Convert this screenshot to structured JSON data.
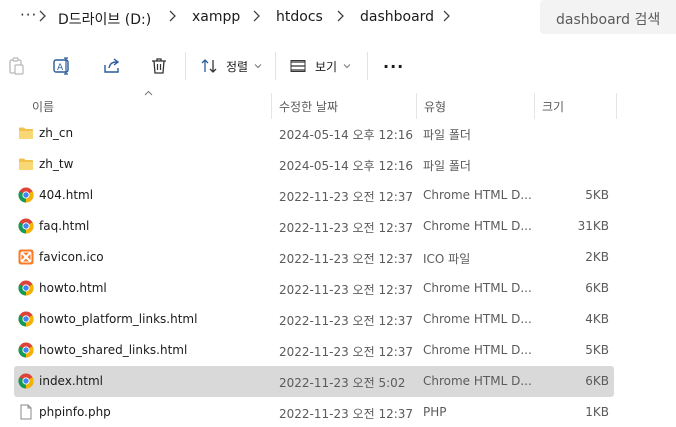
{
  "address_bar": {
    "overflow": "···",
    "breadcrumbs": [
      "D드라이브 (D:)",
      "xampp",
      "htdocs",
      "dashboard"
    ],
    "search_placeholder": "dashboard 검색"
  },
  "toolbar": {
    "sort_label": "정렬",
    "view_label": "보기",
    "more_label": "···"
  },
  "columns": {
    "name": "이름",
    "modified": "수정한 날짜",
    "type": "유형",
    "size": "크기"
  },
  "files": [
    {
      "name": "zh_cn",
      "modified": "2024-05-14 오후 12:16",
      "type": "파일 폴더",
      "size": "",
      "icon": "folder-icon",
      "selected": false
    },
    {
      "name": "zh_tw",
      "modified": "2024-05-14 오후 12:16",
      "type": "파일 폴더",
      "size": "",
      "icon": "folder-icon",
      "selected": false
    },
    {
      "name": "404.html",
      "modified": "2022-11-23 오전 12:37",
      "type": "Chrome HTML D...",
      "size": "5KB",
      "icon": "chrome-icon",
      "selected": false
    },
    {
      "name": "faq.html",
      "modified": "2022-11-23 오전 12:37",
      "type": "Chrome HTML D...",
      "size": "31KB",
      "icon": "chrome-icon",
      "selected": false
    },
    {
      "name": "favicon.ico",
      "modified": "2022-11-23 오전 12:37",
      "type": "ICO 파일",
      "size": "2KB",
      "icon": "xampp-icon",
      "selected": false
    },
    {
      "name": "howto.html",
      "modified": "2022-11-23 오전 12:37",
      "type": "Chrome HTML D...",
      "size": "6KB",
      "icon": "chrome-icon",
      "selected": false
    },
    {
      "name": "howto_platform_links.html",
      "modified": "2022-11-23 오전 12:37",
      "type": "Chrome HTML D...",
      "size": "4KB",
      "icon": "chrome-icon",
      "selected": false
    },
    {
      "name": "howto_shared_links.html",
      "modified": "2022-11-23 오전 12:37",
      "type": "Chrome HTML D...",
      "size": "5KB",
      "icon": "chrome-icon",
      "selected": false
    },
    {
      "name": "index.html",
      "modified": "2022-11-23 오전 5:02",
      "type": "Chrome HTML D...",
      "size": "6KB",
      "icon": "chrome-icon",
      "selected": true
    },
    {
      "name": "phpinfo.php",
      "modified": "2022-11-23 오전 12:37",
      "type": "PHP",
      "size": "1KB",
      "icon": "file-icon",
      "selected": false
    }
  ]
}
